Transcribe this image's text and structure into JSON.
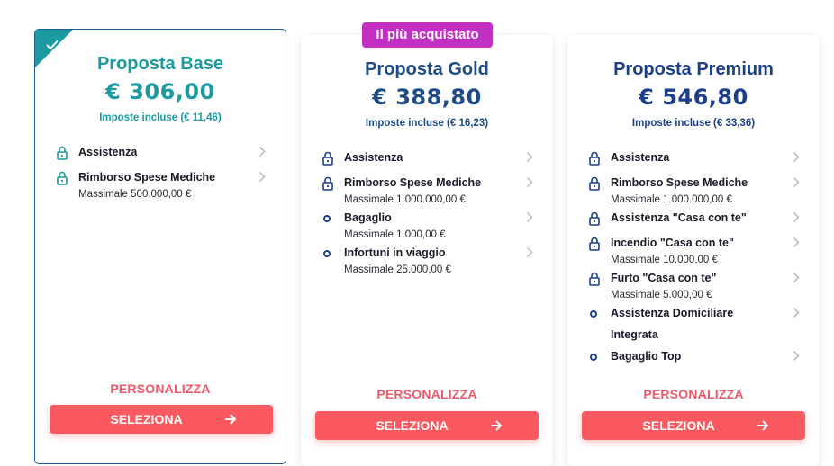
{
  "badge": {
    "label": "Il più acquistato"
  },
  "cards": [
    {
      "title": "Proposta Base",
      "price": "€ 306,00",
      "tax": "Imposte incluse (€ 11,46)",
      "selected": true,
      "features": [
        {
          "label": "Assistenza",
          "sub": "",
          "icon": "lock-icon"
        },
        {
          "label": "Rimborso Spese Mediche",
          "sub": "Massimale 500.000,00 €",
          "icon": "lock-icon"
        }
      ],
      "customize": "PERSONALIZZA",
      "select": "SELEZIONA"
    },
    {
      "title": "Proposta Gold",
      "price": "€ 388,80",
      "tax": "Imposte incluse (€ 16,23)",
      "selected": false,
      "features": [
        {
          "label": "Assistenza",
          "sub": "",
          "icon": "lock-icon"
        },
        {
          "label": "Rimborso Spese Mediche",
          "sub": "Massimale 1.000.000,00 €",
          "icon": "lock-icon"
        },
        {
          "label": "Bagaglio",
          "sub": "Massimale 1.000,00 €",
          "icon": "circle-icon"
        },
        {
          "label": "Infortuni in viaggio",
          "sub": "Massimale 25.000,00 €",
          "icon": "circle-icon"
        }
      ],
      "customize": "PERSONALIZZA",
      "select": "SELEZIONA"
    },
    {
      "title": "Proposta Premium",
      "price": "€ 546,80",
      "tax": "Imposte incluse (€ 33,36)",
      "selected": false,
      "features": [
        {
          "label": "Assistenza",
          "sub": "",
          "icon": "lock-icon"
        },
        {
          "label": "Rimborso Spese Mediche",
          "sub": "Massimale 1.000.000,00 €",
          "icon": "lock-icon"
        },
        {
          "label": "Assistenza \"Casa con te\"",
          "sub": "",
          "icon": "lock-icon"
        },
        {
          "label": "Incendio \"Casa con te\"",
          "sub": "Massimale 10.000,00 €",
          "icon": "lock-icon"
        },
        {
          "label": "Furto \"Casa con te\"",
          "sub": "Massimale 5.000,00 €",
          "icon": "lock-icon"
        },
        {
          "label": "Assistenza Domiciliare",
          "sub": "Integrata",
          "icon": "circle-icon"
        },
        {
          "label": "Bagaglio Top",
          "sub": "",
          "icon": "circle-icon"
        }
      ],
      "customize": "PERSONALIZZA",
      "select": "SELEZIONA"
    }
  ],
  "colors": {
    "teal": "#1b9aa0",
    "navy": "#1b3f8b",
    "badge": "#c22fc4",
    "cta": "#f9595f",
    "customize": "#f0596a"
  }
}
